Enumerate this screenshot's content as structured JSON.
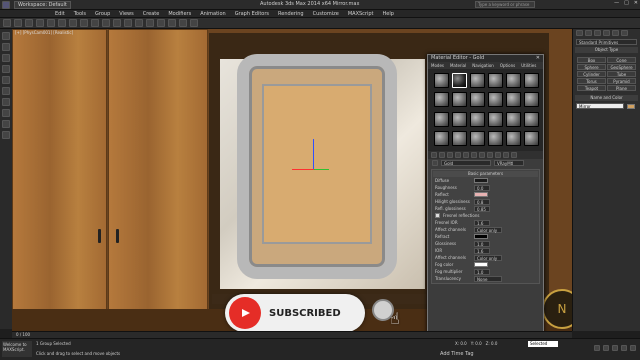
{
  "titlebar": {
    "workspace": "Workspace: Default",
    "title": "Autodesk 3ds Max  2014 x64    Mirror.max",
    "search_placeholder": "Type a keyword or phrase"
  },
  "menus": [
    "Edit",
    "Tools",
    "Group",
    "Views",
    "Create",
    "Modifiers",
    "Animation",
    "Graph Editors",
    "Rendering",
    "Customize",
    "MAXScript",
    "Help"
  ],
  "viewport": {
    "label": "[+] [PhysCam001] [Realistic]"
  },
  "overlay": {
    "subscribe": "SUBSCRIBED",
    "logo_letter": "N"
  },
  "material_editor": {
    "title": "Material Editor - Gold",
    "menus": [
      "Modes",
      "Material",
      "Navigation",
      "Options",
      "Utilities"
    ],
    "name_field": "Gold",
    "type_button": "VRayMtl",
    "basic_header": "Basic parameters",
    "rows": [
      {
        "label": "Diffuse"
      },
      {
        "label": "Roughness",
        "value": "0.0"
      },
      {
        "label": "Reflect"
      },
      {
        "label": "Hilight glossiness",
        "value": "0.8"
      },
      {
        "label": "Refl. glossiness",
        "value": "0.85"
      },
      {
        "label": "Fresnel reflections"
      },
      {
        "label": "Fresnel IOR",
        "value": "1.6"
      },
      {
        "label": "Affect channels",
        "value": "Color only"
      },
      {
        "label": "Refract"
      },
      {
        "label": "Glossiness",
        "value": "1.0"
      },
      {
        "label": "IOR",
        "value": "1.6"
      },
      {
        "label": "Affect channels",
        "value": "Color only"
      },
      {
        "label": "Fog color"
      },
      {
        "label": "Fog multiplier",
        "value": "1.0"
      },
      {
        "label": "Translucency",
        "value": "None"
      }
    ]
  },
  "command_panel": {
    "category": "Standard Primitives",
    "object_type_header": "Object Type",
    "objects": [
      "Box",
      "Cone",
      "Sphere",
      "GeoSphere",
      "Cylinder",
      "Tube",
      "Torus",
      "Pyramid",
      "Teapot",
      "Plane"
    ],
    "name_color_header": "Name and Color",
    "name_value": "Mirror"
  },
  "timeline": {
    "counter": "0 / 100"
  },
  "status": {
    "maxscript": "Welcome to MAXScript.",
    "line1": "1 Group Selected",
    "line2": "Click and drag to select and move objects",
    "x": "X: 0.0",
    "y": "Y: 0.0",
    "z": "Z: 0.0",
    "selected": "Selected",
    "add_time_tag": "Add Time Tag"
  }
}
